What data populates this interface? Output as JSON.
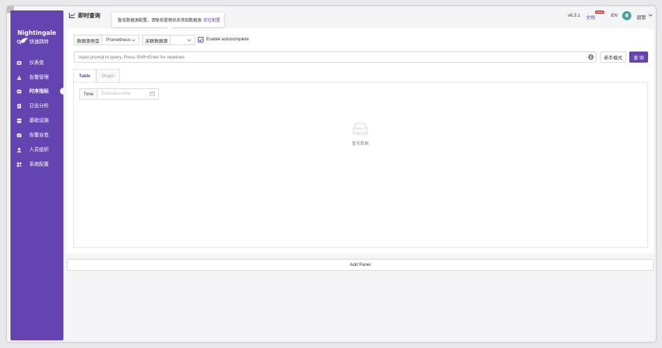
{
  "app": {
    "logo_text": "Nightingale"
  },
  "sidebar": {
    "items": [
      {
        "label": "快速跳转",
        "icon": "search-icon"
      },
      {
        "label": "仪表盘",
        "icon": "dashboard-icon"
      },
      {
        "label": "告警管理",
        "icon": "alert-icon"
      },
      {
        "label": "时序指标",
        "icon": "metrics-icon",
        "active": true
      },
      {
        "label": "日志分析",
        "icon": "log-icon"
      },
      {
        "label": "基础设施",
        "icon": "infra-icon"
      },
      {
        "label": "告警自愈",
        "icon": "self-heal-icon"
      },
      {
        "label": "人员组织",
        "icon": "user-icon"
      },
      {
        "label": "系统配置",
        "icon": "settings-icon"
      }
    ]
  },
  "header": {
    "title": "即时查询",
    "tooltip_text": "暂无数据源配置，请联系管理员去添加数据源",
    "tooltip_link": "前往配置",
    "version": "v6.3.1",
    "docs_label": "文档",
    "new_badge": "NEW",
    "lang": "EN",
    "username": "超管"
  },
  "query_bar": {
    "datasource_type_label": "数据源类型",
    "datasource_type_value": "Prometheus",
    "datasource_label": "关联数据源",
    "datasource_value": "",
    "autocomplete_label": "Enable autocomplete",
    "autocomplete_checked": true,
    "input_placeholder": "Input promql to query. Press Shift+Enter for newlines",
    "novice_mode_label": "新手模式",
    "query_button": "查 询"
  },
  "tabs": [
    {
      "label": "Table",
      "active": true
    },
    {
      "label": "Graph",
      "active": false
    }
  ],
  "table_panel": {
    "time_label": "Time",
    "time_placeholder": "Evaluation time",
    "empty_text": "暂无数据"
  },
  "add_panel_label": "Add Panel",
  "colors": {
    "accent": "#6344b0",
    "sidebar_bg": "#6344b0",
    "badge": "#e53935"
  }
}
